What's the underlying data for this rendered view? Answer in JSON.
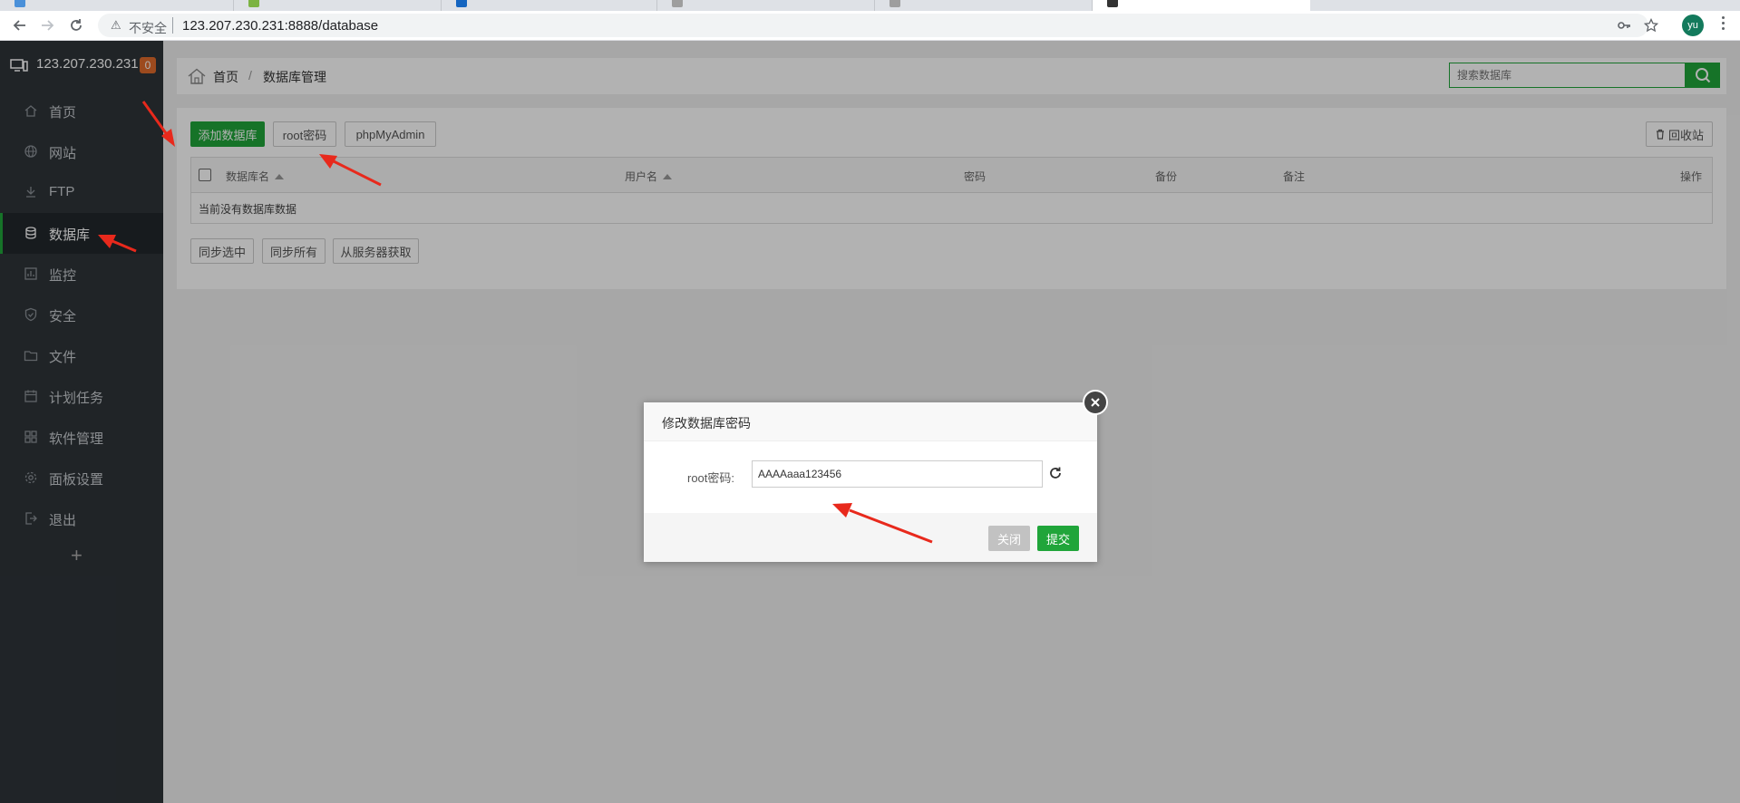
{
  "browser": {
    "security_label": "不安全",
    "url": "123.207.230.231:8888/database",
    "avatar_initials": "yu",
    "tab_favicon_colors": [
      "#4a90d9",
      "#7cb342",
      "#1565c0",
      "#9e9e9e",
      "#9e9e9e",
      "#333333"
    ]
  },
  "sidebar": {
    "server_ip": "123.207.230.231",
    "badge_count": "0",
    "items": [
      {
        "label": "首页",
        "icon": "home-icon"
      },
      {
        "label": "网站",
        "icon": "globe-icon"
      },
      {
        "label": "FTP",
        "icon": "ftp-icon"
      },
      {
        "label": "数据库",
        "icon": "database-icon",
        "active": true
      },
      {
        "label": "监控",
        "icon": "monitor-icon"
      },
      {
        "label": "安全",
        "icon": "shield-icon"
      },
      {
        "label": "文件",
        "icon": "folder-icon"
      },
      {
        "label": "计划任务",
        "icon": "calendar-icon"
      },
      {
        "label": "软件管理",
        "icon": "grid-icon"
      },
      {
        "label": "面板设置",
        "icon": "gear-icon"
      },
      {
        "label": "退出",
        "icon": "logout-icon"
      }
    ],
    "add_label": "+"
  },
  "breadcrumb": {
    "home": "首页",
    "separator": "/",
    "current": "数据库管理"
  },
  "search": {
    "placeholder": "搜索数据库"
  },
  "toolbar": {
    "add_db": "添加数据库",
    "root_pwd": "root密码",
    "phpmyadmin": "phpMyAdmin",
    "recycle": "回收站"
  },
  "table": {
    "columns": [
      "数据库名",
      "用户名",
      "密码",
      "备份",
      "备注",
      "操作"
    ],
    "empty_text": "当前没有数据库数据"
  },
  "bottom_buttons": {
    "sync_selected": "同步选中",
    "sync_all": "同步所有",
    "fetch_server": "从服务器获取"
  },
  "modal": {
    "title": "修改数据库密码",
    "field_label": "root密码:",
    "field_value": "AAAAaaa123456",
    "close_btn": "关闭",
    "submit_btn": "提交"
  },
  "colors": {
    "accent": "#20a53a",
    "sidebar_bg": "#2e3439",
    "badge": "#e06a2b",
    "annotation_arrow": "#e8291c"
  }
}
